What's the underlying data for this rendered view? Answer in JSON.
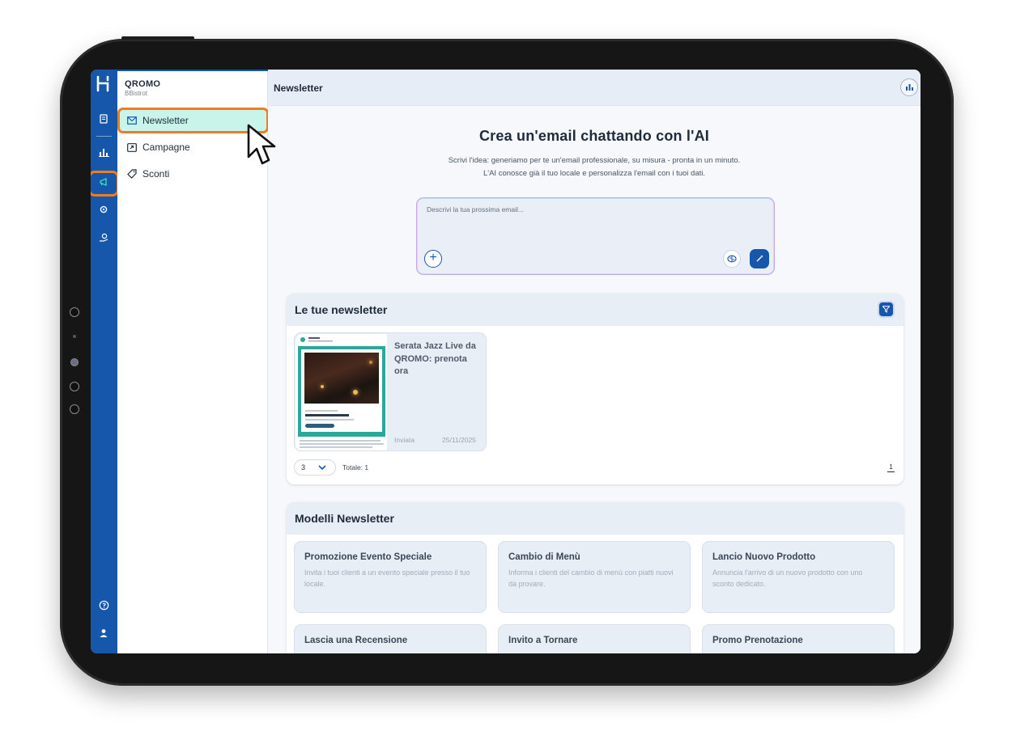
{
  "brand": {
    "name": "QROMO",
    "subtitle": "BBistrot"
  },
  "colors": {
    "primary": "#1657ab",
    "highlight": "#ee7d22",
    "active_bg": "#c9f4ea",
    "rail": "#1657ab"
  },
  "rail": {
    "icons": [
      "logo-icon",
      "receipt-icon",
      "bar-chart-icon",
      "megaphone-icon",
      "settings-icon",
      "hand-coin-icon",
      "help-icon",
      "user-icon"
    ]
  },
  "sidebar": {
    "items": [
      {
        "label": "Newsletter",
        "icon": "mail-icon",
        "active": true
      },
      {
        "label": "Campagne",
        "icon": "campaign-icon",
        "active": false
      },
      {
        "label": "Sconti",
        "icon": "discount-tag-icon",
        "active": false
      }
    ]
  },
  "header": {
    "title": "Newsletter"
  },
  "hero": {
    "title": "Crea un'email chattando con l'AI",
    "subtitle_line1": "Scrivi l'idea: generiamo per te un'email professionale, su misura - pronta in un minuto.",
    "subtitle_line2": "L'AI conosce già il tuo locale e personalizza l'email con i tuoi dati.",
    "placeholder": "Descrivi la tua prossima email..."
  },
  "newsletters": {
    "heading": "Le tue newsletter",
    "items": [
      {
        "title": "Serata Jazz Live da QROMO: prenota ora",
        "status": "Inviata",
        "date": "25/11/2025"
      }
    ],
    "page_size": "3",
    "total": "Totale: 1",
    "page": "1"
  },
  "templates": {
    "heading": "Modelli Newsletter",
    "items": [
      {
        "title": "Promozione Evento Speciale",
        "desc": "Invita i tuoi clienti a un evento speciale presso il tuo locale."
      },
      {
        "title": "Cambio di Menù",
        "desc": "Informa i clienti del cambio di menù con piatti nuovi da provare."
      },
      {
        "title": "Lancio Nuovo Prodotto",
        "desc": "Annuncia l'arrivo di un nuovo prodotto con uno sconto dedicato."
      },
      {
        "title": "Lascia una Recensione",
        "desc": ""
      },
      {
        "title": "Invito a Tornare",
        "desc": ""
      },
      {
        "title": "Promo Prenotazione",
        "desc": ""
      }
    ]
  }
}
